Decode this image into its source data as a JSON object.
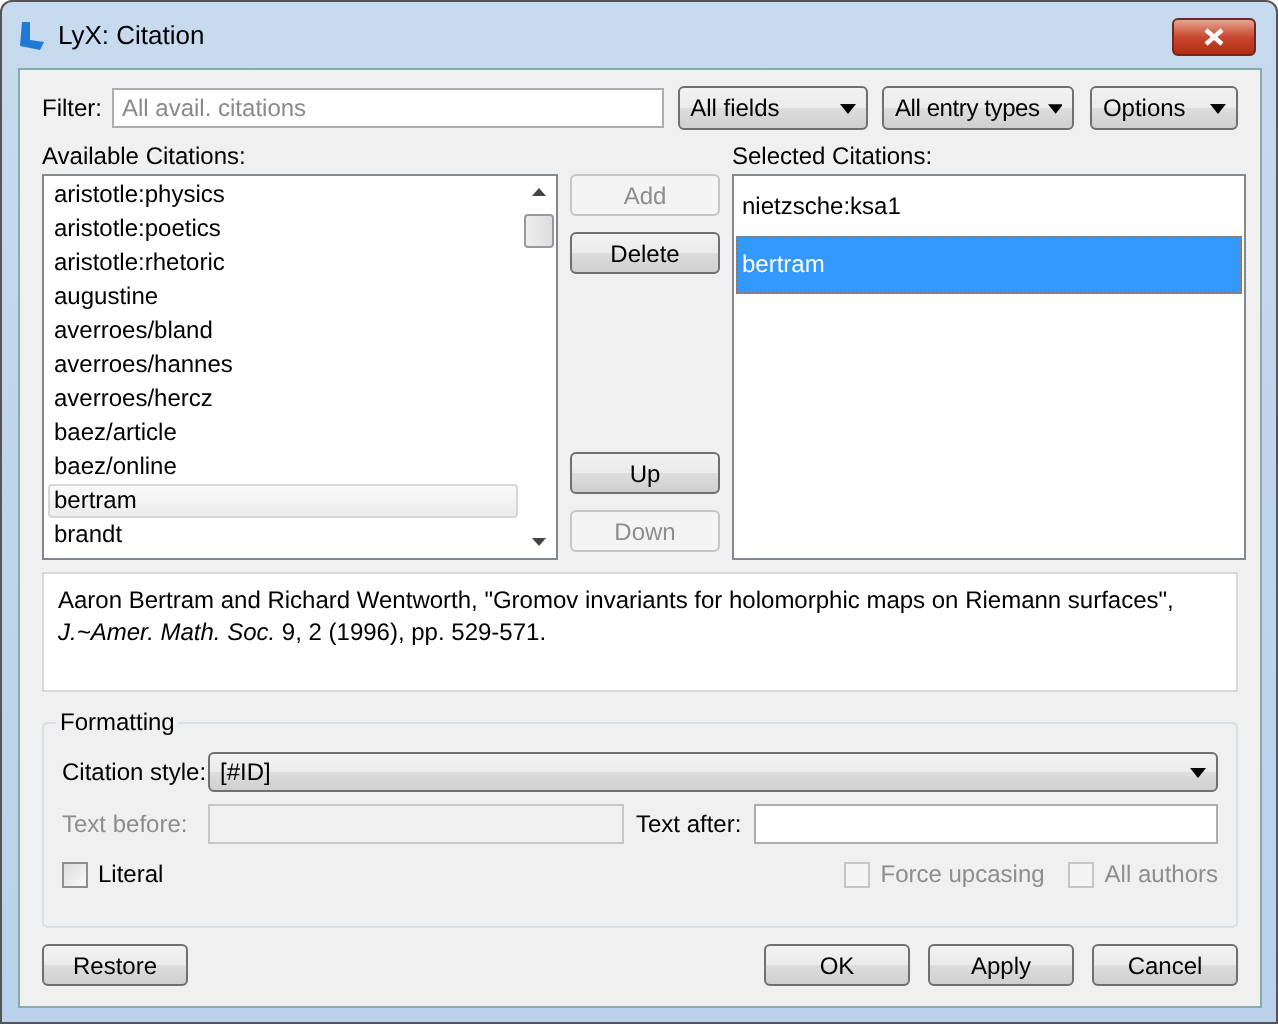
{
  "window": {
    "title": "LyX: Citation"
  },
  "filter": {
    "label": "Filter:",
    "placeholder": "All avail. citations"
  },
  "dropdowns": [
    {
      "value": "All fields"
    },
    {
      "value": "All entry types"
    }
  ],
  "options_button": "Options",
  "available": {
    "label": "Available Citations:",
    "items": [
      {
        "text": "aristotle:physics",
        "selected": false
      },
      {
        "text": "aristotle:poetics",
        "selected": false
      },
      {
        "text": "aristotle:rhetoric",
        "selected": false
      },
      {
        "text": "augustine",
        "selected": false
      },
      {
        "text": "averroes/bland",
        "selected": false
      },
      {
        "text": "averroes/hannes",
        "selected": false
      },
      {
        "text": "averroes/hercz",
        "selected": false
      },
      {
        "text": "baez/article",
        "selected": false
      },
      {
        "text": "baez/online",
        "selected": false
      },
      {
        "text": "bertram",
        "selected": true
      },
      {
        "text": "brandt",
        "selected": false
      }
    ]
  },
  "middle_buttons": [
    {
      "label": "Add",
      "disabled": true
    },
    {
      "label": "Delete",
      "disabled": false
    },
    {
      "label": "Up",
      "disabled": false
    },
    {
      "label": "Down",
      "disabled": true
    }
  ],
  "selected_citations": {
    "label": "Selected Citations:",
    "items": [
      {
        "text": "nietzsche:ksa1",
        "selected": false
      },
      {
        "text": "bertram",
        "selected": true
      }
    ]
  },
  "info": "Aaron Bertram and Richard Wentworth, \"Gromov invariants for holomorphic maps on Riemann surfaces\", *J.~Amer. Math. Soc.* 9, 2 (1996), pp. 529-571.",
  "formatting": {
    "title": "Formatting",
    "citation_style": {
      "label": "Citation style:",
      "value": "[#ID]"
    },
    "text_before": {
      "label": "Text before:",
      "disabled": true
    },
    "text_after": {
      "label": "Text after:",
      "disabled": false
    },
    "checkboxes": [
      {
        "label": "Literal",
        "checked": false,
        "disabled": false
      },
      {
        "label": "Force upcasing",
        "checked": false,
        "disabled": true
      },
      {
        "label": "All authors",
        "checked": false,
        "disabled": true
      }
    ]
  },
  "bottom_buttons": [
    {
      "label": "Restore"
    },
    {
      "label": "OK"
    },
    {
      "label": "Apply"
    },
    {
      "label": "Cancel"
    }
  ]
}
